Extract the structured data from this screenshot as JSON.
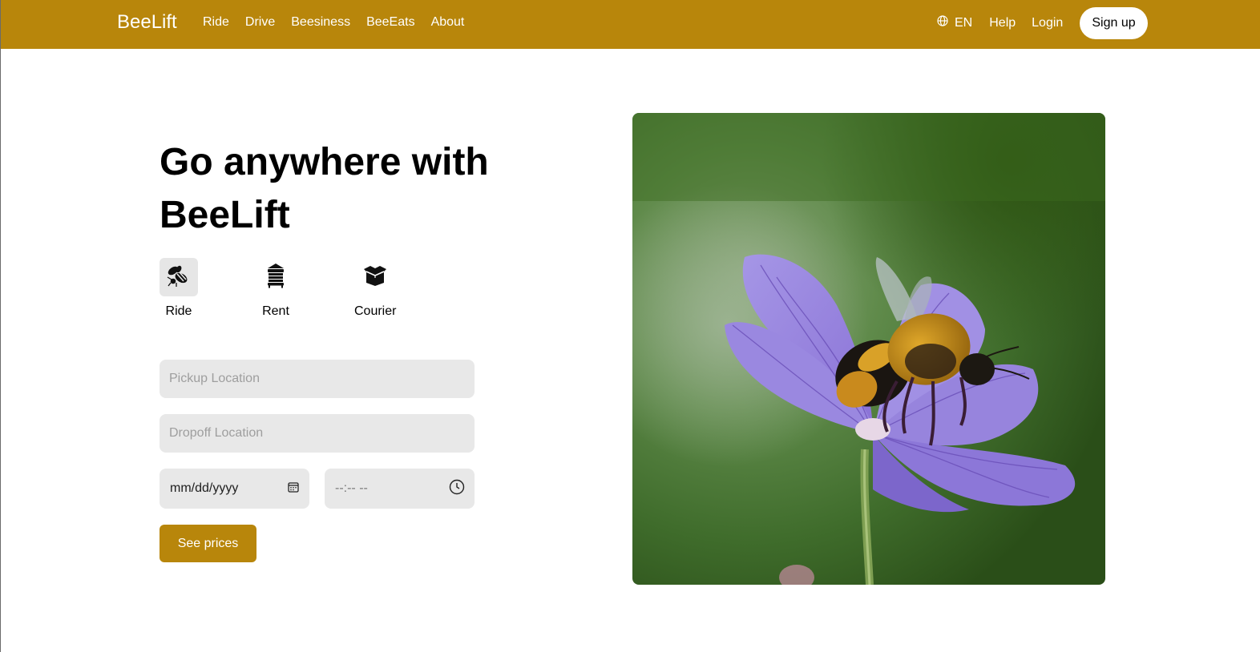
{
  "nav": {
    "brand": "BeeLift",
    "links": [
      "Ride",
      "Drive",
      "Beesiness",
      "BeeEats",
      "About"
    ],
    "language": "EN",
    "help": "Help",
    "login": "Login",
    "signup": "Sign up"
  },
  "hero": {
    "title": "Go anywhere with BeeLift",
    "modes": [
      {
        "label": "Ride",
        "icon": "bee-icon",
        "active": true
      },
      {
        "label": "Rent",
        "icon": "beehive-icon",
        "active": false
      },
      {
        "label": "Courier",
        "icon": "box-icon",
        "active": false
      }
    ],
    "pickup_placeholder": "Pickup Location",
    "dropoff_placeholder": "Dropoff Location",
    "date_value": "mm/dd/yyyy",
    "time_value": "--:-- --",
    "cta": "See prices"
  },
  "colors": {
    "accent": "#b8860b",
    "input_bg": "#e8e8e8"
  }
}
